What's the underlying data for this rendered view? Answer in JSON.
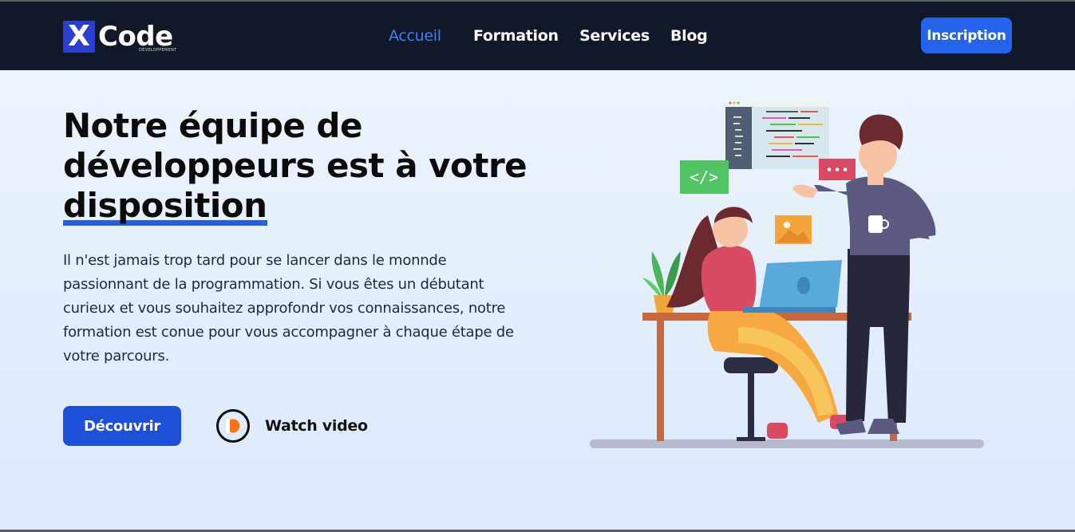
{
  "logo": {
    "mark": "X",
    "word": "Code",
    "tagline": "DÉVELOPPEMENT"
  },
  "nav": {
    "items": [
      {
        "label": "Accueil",
        "active": true
      },
      {
        "label": "Formation",
        "active": false
      },
      {
        "label": "Services",
        "active": false
      },
      {
        "label": "Blog",
        "active": false
      }
    ],
    "signup_label": "Inscription"
  },
  "hero": {
    "title_part1": "Notre équipe de développeurs est à votre",
    "title_highlight": "disposition",
    "paragraph": "Il n'est jamais trop tard pour se lancer dans le monnde passionnant de la programmation. Si vous êtes un débutant curieux et vous souhaitez approfondr vos connaissances, notre formation est conue pour vous accompagner à chaque étape de votre parcours.",
    "cta_label": "Découvrir",
    "video_label": "Watch video"
  },
  "colors": {
    "navbar": "#111827",
    "accent": "#2563eb",
    "active_link": "#3b82f6",
    "play_icon": "#f97316"
  },
  "icons": [
    "play-icon",
    "code-tag-icon",
    "chat-dots-icon",
    "image-icon"
  ]
}
